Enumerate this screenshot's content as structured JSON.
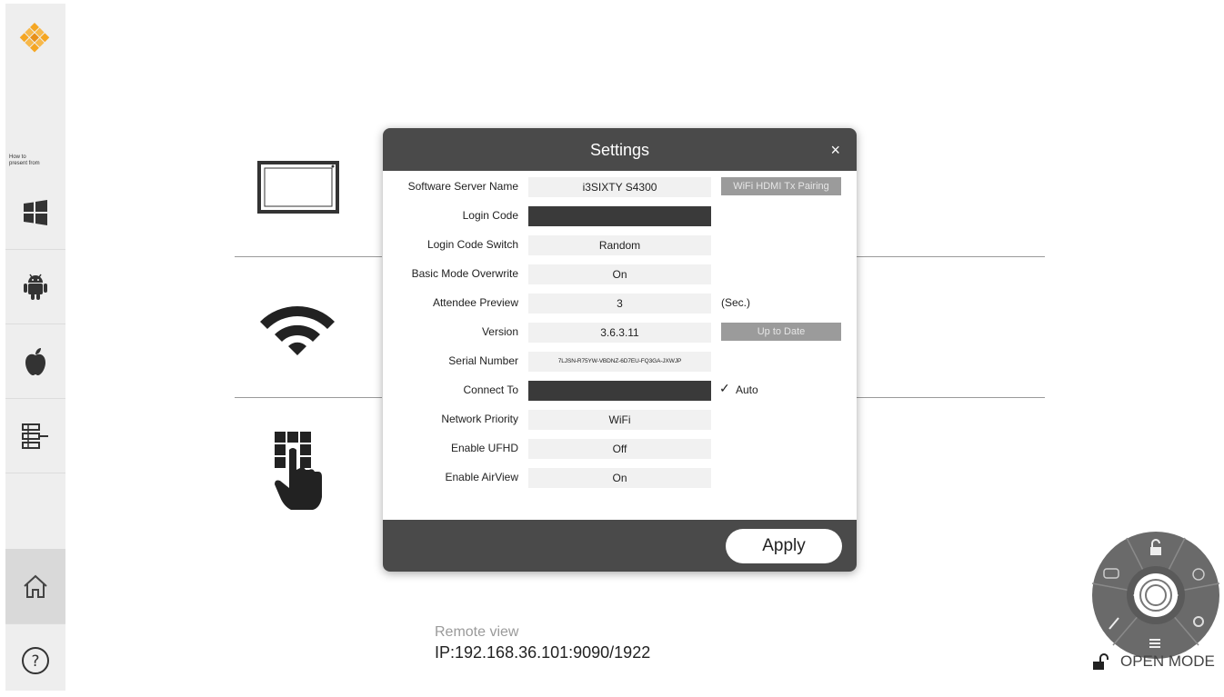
{
  "sidebar": {
    "howto_line1": "How to",
    "howto_line2": "present from",
    "items": [
      {
        "icon": "windows-icon"
      },
      {
        "icon": "android-icon"
      },
      {
        "icon": "apple-icon"
      },
      {
        "icon": "list-settings-icon"
      },
      {
        "icon": "home-icon"
      },
      {
        "icon": "help-icon"
      }
    ]
  },
  "background": {
    "remote_label": "Remote view",
    "remote_ip": "IP:192.168.36.101:9090/1922"
  },
  "dialog": {
    "title": "Settings",
    "close": "×",
    "rows": [
      {
        "label": "Software Server Name",
        "value": "i3SIXTY S4300",
        "extra_button": "WiFi HDMI Tx Pairing"
      },
      {
        "label": "Login Code",
        "value": ""
      },
      {
        "label": "Login Code Switch",
        "value": "Random"
      },
      {
        "label": "Basic Mode Overwrite",
        "value": "On"
      },
      {
        "label": "Attendee Preview",
        "value": "3",
        "extra_text": "(Sec.)"
      },
      {
        "label": "Version",
        "value": "3.6.3.11",
        "extra_button": "Up to Date"
      },
      {
        "label": "Serial Number",
        "value": "7LJSN-R75YW-VBDNZ-6D7EU-FQ3GA-JXWJP"
      },
      {
        "label": "Connect To",
        "value": "",
        "check": "✓",
        "extra_text": "Auto"
      },
      {
        "label": "Network Priority",
        "value": "WiFi"
      },
      {
        "label": "Enable UFHD",
        "value": "Off"
      },
      {
        "label": "Enable AirView",
        "value": "On"
      }
    ],
    "apply_label": "Apply"
  },
  "wheel": {
    "open_mode_label": "OPEN MODE"
  },
  "colors": {
    "header": "#4a4a4a",
    "field": "#f1f1f1",
    "dark_field": "#3a3a3a",
    "side_button": "#9b9b9b",
    "logo_orange": "#f5a623"
  }
}
